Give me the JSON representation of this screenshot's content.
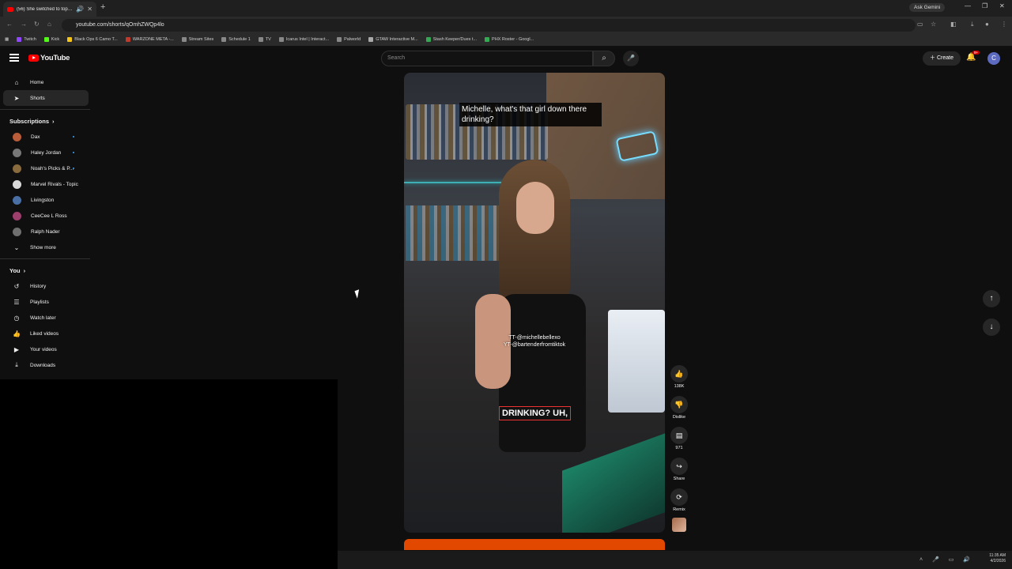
{
  "browser": {
    "tab_title": "(56) She switched to top sh",
    "url": "youtube.com/shorts/qOmhZWQp4lo",
    "ask_gemini": "Ask Gemini",
    "bookmarks": [
      {
        "label": "Twitch",
        "color": "#9146ff"
      },
      {
        "label": "Kick",
        "color": "#53fc18"
      },
      {
        "label": "Black Ops 6 Camo T...",
        "color": "#f5c518"
      },
      {
        "label": "WARZONE META -...",
        "color": "#c0392b"
      },
      {
        "label": "Stream Sites",
        "color": "#888888"
      },
      {
        "label": "Schedule 1",
        "color": "#888888"
      },
      {
        "label": "TV",
        "color": "#888888"
      },
      {
        "label": "Icarus Intel | Interact...",
        "color": "#888888"
      },
      {
        "label": "Palworld",
        "color": "#888888"
      },
      {
        "label": "GTAW Interactive M...",
        "color": "#aaaaaa"
      },
      {
        "label": "Stash Keeper/Dues t...",
        "color": "#34a853"
      },
      {
        "label": "PHX Roster - Googl...",
        "color": "#34a853"
      }
    ]
  },
  "youtube": {
    "logo_text": "YouTube",
    "search_placeholder": "Search",
    "create_label": "Create",
    "notif_count": "9+",
    "avatar_letter": "C"
  },
  "sidebar": {
    "main": [
      {
        "label": "Home",
        "icon": "⌂"
      },
      {
        "label": "Shorts",
        "icon": "➤"
      }
    ],
    "subscriptions_title": "Subscriptions",
    "subscriptions": [
      {
        "label": "Dax",
        "color": "#b85c3a",
        "dot": true
      },
      {
        "label": "Haley Jordan",
        "color": "#777777",
        "dot": true
      },
      {
        "label": "Noah's Picks & P...",
        "color": "#8a6b3d",
        "dot": true
      },
      {
        "label": "Marvel Rivals - Topic",
        "color": "#d9d9d9",
        "dot": false
      },
      {
        "label": "Livingston",
        "color": "#4a6fa5",
        "dot": false
      },
      {
        "label": "CeeCee L Ross",
        "color": "#9c3f6d",
        "dot": false
      },
      {
        "label": "Ralph Nader",
        "color": "#6f6f6f",
        "dot": false
      }
    ],
    "show_more": "Show more",
    "you_title": "You",
    "you_items": [
      {
        "label": "History",
        "icon": "↺"
      },
      {
        "label": "Playlists",
        "icon": "☰"
      },
      {
        "label": "Watch later",
        "icon": "◷"
      },
      {
        "label": "Liked videos",
        "icon": "👍"
      },
      {
        "label": "Your videos",
        "icon": "▶"
      },
      {
        "label": "Downloads",
        "icon": "⤓"
      }
    ]
  },
  "short": {
    "caption_top": "Michelle, what's that girl down there drinking?",
    "watermark_line1": "TT-@michellebellexo",
    "watermark_line2": "YT-@bartenderfromtiktok",
    "caption_mid": "DRINKING? UH,",
    "like_count": "138K",
    "dislike_label": "Dislike",
    "comment_count": "971",
    "share_label": "Share",
    "remix_label": "Remix"
  },
  "taskbar": {
    "time": "11:35 AM",
    "date": "4/2/2026"
  }
}
